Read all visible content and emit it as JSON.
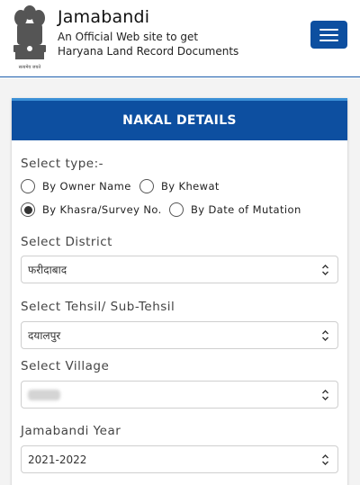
{
  "header": {
    "site_title": "Jamabandi",
    "tagline_line1": "An Official Web site to get",
    "tagline_line2": "Haryana Land Record Documents",
    "emblem_motto": "सत्यमेव जयते",
    "menu_icon": "hamburger-icon"
  },
  "form": {
    "heading": "NAKAL DETAILS",
    "select_type_label": "Select type:-",
    "type_options": [
      {
        "label": "By Owner Name",
        "selected": false
      },
      {
        "label": "By Khewat",
        "selected": false
      },
      {
        "label": "By Khasra/Survey No.",
        "selected": true
      },
      {
        "label": "By Date of Mutation",
        "selected": false
      }
    ],
    "district_label": "Select District",
    "district_value": "फरीदाबाद",
    "tehsil_label": "Select Tehsil/ Sub-Tehsil",
    "tehsil_value": "दयालपुर",
    "village_label": "Select Village",
    "village_value": "",
    "year_label": "Jamabandi Year",
    "year_value": "2021-2022"
  },
  "colors": {
    "primary": "#0d4fa0",
    "accent_top": "#3a8fd6",
    "page_bg": "#f3f3f3"
  }
}
